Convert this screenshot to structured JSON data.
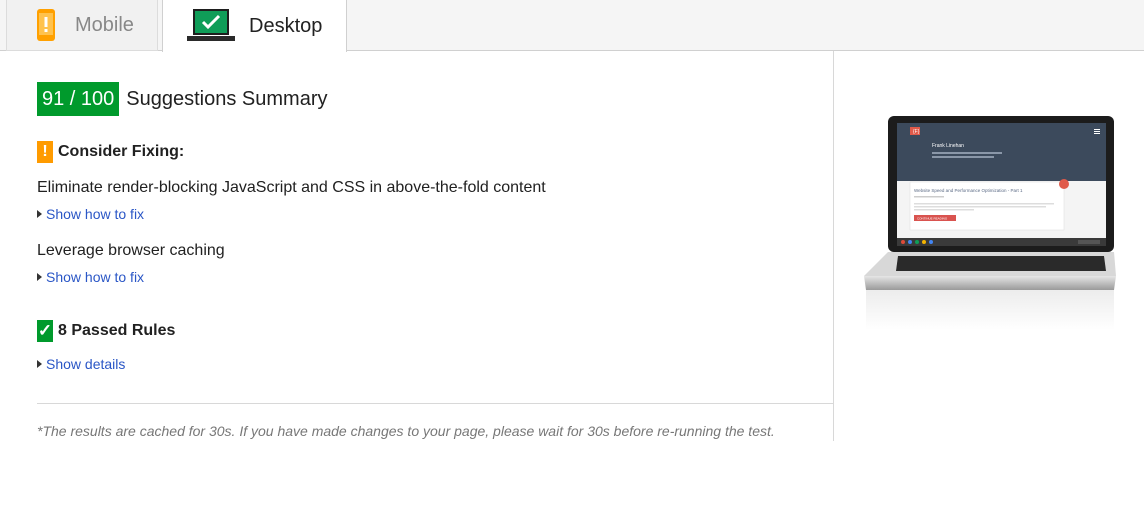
{
  "tabs": [
    {
      "label": "Mobile",
      "icon": "phone-warning-icon",
      "active": false
    },
    {
      "label": "Desktop",
      "icon": "monitor-check-icon",
      "active": true
    }
  ],
  "summary": {
    "score": "91 / 100",
    "title": "Suggestions Summary",
    "score_color": "#009a2c"
  },
  "consider_fixing": {
    "icon": "!",
    "title": "Consider Fixing:",
    "color": "#ff9b00",
    "rules": [
      {
        "text": "Eliminate render-blocking JavaScript and CSS in above-the-fold content",
        "link": "Show how to fix"
      },
      {
        "text": "Leverage browser caching",
        "link": "Show how to fix"
      }
    ]
  },
  "passed": {
    "icon": "✓",
    "title": "8 Passed Rules",
    "link": "Show details"
  },
  "footnote": "*The results are cached for 30s. If you have made changes to your page, please wait for 30s before re-running the test.",
  "preview": {
    "site_name": "Frank Linehan",
    "post_title": "Website Speed and Performance Optimization - Part 1",
    "button": "CONTINUE READING"
  },
  "link_color": "#2a56c6"
}
